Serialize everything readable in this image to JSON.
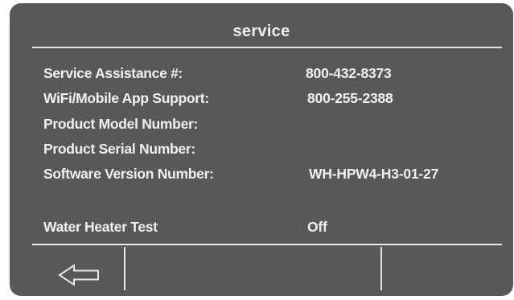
{
  "header": {
    "title": "service"
  },
  "info": [
    {
      "label": "Service Assistance #:",
      "value": "800-432-8373"
    },
    {
      "label": "WiFi/Mobile App Support:",
      "value": "800-255-2388"
    },
    {
      "label": "Product Model Number:",
      "value": ""
    },
    {
      "label": "Product Serial Number:",
      "value": ""
    },
    {
      "label": "Software Version Number:",
      "value": "WH-HPW4-H3-01-27"
    }
  ],
  "test": {
    "label": "Water Heater Test",
    "value": "Off"
  },
  "footer": {
    "back_icon": "left-arrow-icon"
  },
  "colors": {
    "panel": "#585858",
    "text": "#f0f0f0",
    "rule": "#e6e6e6"
  }
}
